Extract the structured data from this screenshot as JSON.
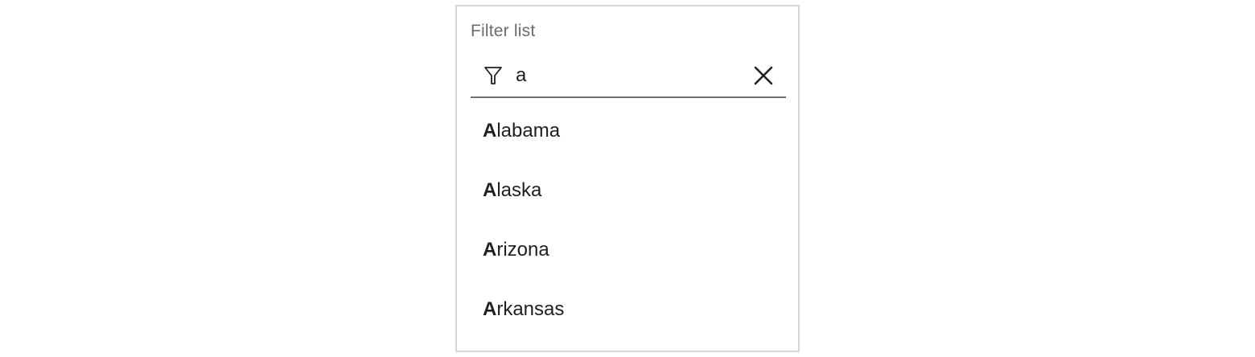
{
  "filter": {
    "label": "Filter list",
    "query": "a",
    "filter_icon": "filter-funnel-icon",
    "clear_icon": "close-icon"
  },
  "results": [
    {
      "match": "A",
      "rest": "labama"
    },
    {
      "match": "A",
      "rest": "laska"
    },
    {
      "match": "A",
      "rest": "rizona"
    },
    {
      "match": "A",
      "rest": "rkansas"
    }
  ],
  "colors": {
    "panel_border": "#d6d6d6",
    "label_text": "#6b6b6b",
    "underline": "#6e6e6e",
    "text": "#1f1f1f"
  }
}
